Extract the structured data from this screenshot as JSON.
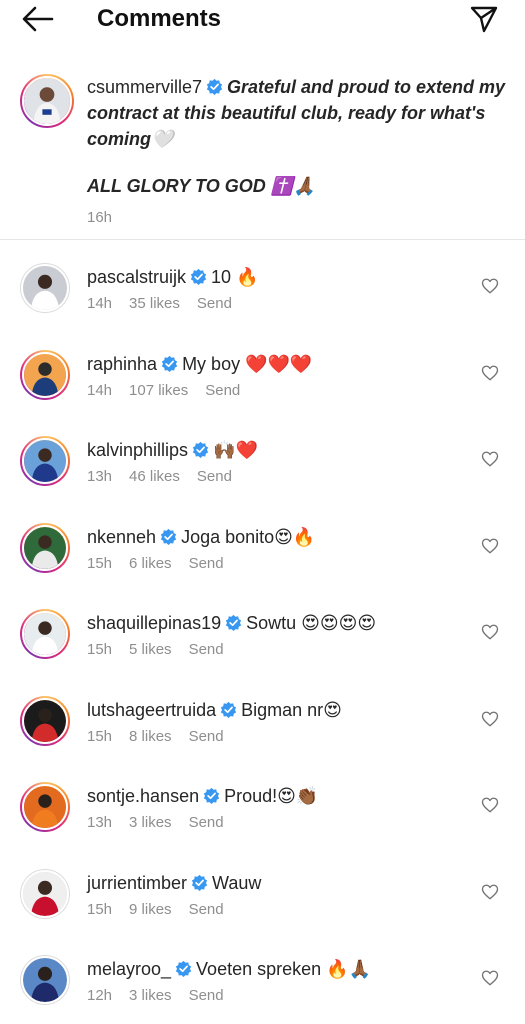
{
  "header": {
    "title": "Comments",
    "back_icon": "arrow-left-icon",
    "share_icon": "paper-plane-icon"
  },
  "caption": {
    "username": "csummerville7",
    "text": "Grateful and proud to extend my contract at this beautiful club, ready for what's coming🤍",
    "text2": "ALL GLORY TO GOD ✝️🙏🏾",
    "time": "16h"
  },
  "comments": [
    {
      "username": "pascalstruijk",
      "text": "10 🔥",
      "time": "14h",
      "likes": "35 likes",
      "reply": "Send",
      "ring": false
    },
    {
      "username": "raphinha",
      "text": "My boy ❤️❤️❤️",
      "time": "14h",
      "likes": "107 likes",
      "reply": "Send",
      "ring": true
    },
    {
      "username": "kalvinphillips",
      "text": "🙌🏾❤️",
      "time": "13h",
      "likes": "46 likes",
      "reply": "Send",
      "ring": true
    },
    {
      "username": "nkenneh",
      "text": "Joga bonito😍🔥",
      "time": "15h",
      "likes": "6 likes",
      "reply": "Send",
      "ring": true
    },
    {
      "username": "shaquillepinas19",
      "text": "Sowtu 😍😍😍😍",
      "time": "15h",
      "likes": "5 likes",
      "reply": "Send",
      "ring": true
    },
    {
      "username": "lutshageertruida",
      "text": "Bigman nr😍",
      "time": "15h",
      "likes": "8 likes",
      "reply": "Send",
      "ring": true
    },
    {
      "username": "sontje.hansen",
      "text": "Proud!😍👏🏾",
      "time": "13h",
      "likes": "3 likes",
      "reply": "Send",
      "ring": true
    },
    {
      "username": "jurrientimber",
      "text": "Wauw",
      "time": "15h",
      "likes": "9 likes",
      "reply": "Send",
      "ring": false
    },
    {
      "username": "melayroo_",
      "text": "Voeten spreken 🔥🙏🏾",
      "time": "12h",
      "likes": "3 likes",
      "reply": "Send",
      "ring": false
    }
  ],
  "colors": {
    "verified": "#3897f0",
    "meta_text": "#8e8e8e",
    "primary_text": "#262626"
  }
}
